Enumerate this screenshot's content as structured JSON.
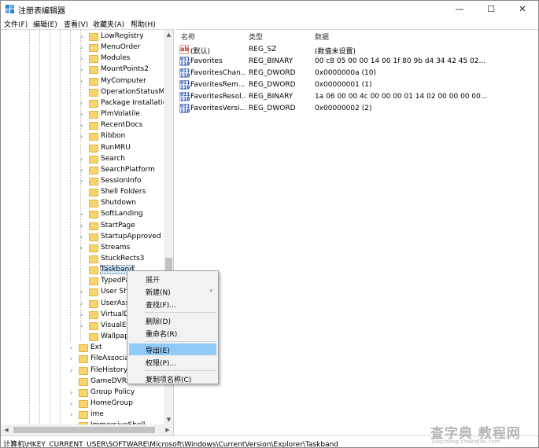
{
  "window": {
    "title": "注册表编辑器",
    "controls": [
      "—",
      "☐",
      "✕"
    ]
  },
  "menubar": [
    "文件(F)",
    "编辑(E)",
    "查看(V)",
    "收藏夹(A)",
    "帮助(H)"
  ],
  "tree": {
    "items": [
      {
        "label": "LowRegistry",
        "depth": 2,
        "expandable": true
      },
      {
        "label": "MenuOrder",
        "depth": 2,
        "expandable": true
      },
      {
        "label": "Modules",
        "depth": 2,
        "expandable": true
      },
      {
        "label": "MountPoints2",
        "depth": 2,
        "expandable": true
      },
      {
        "label": "MyComputer",
        "depth": 2,
        "expandable": true
      },
      {
        "label": "OperationStatusMa",
        "depth": 2,
        "expandable": false
      },
      {
        "label": "Package Installation",
        "depth": 2,
        "expandable": true
      },
      {
        "label": "PlmVolatile",
        "depth": 2,
        "expandable": true
      },
      {
        "label": "RecentDocs",
        "depth": 2,
        "expandable": true
      },
      {
        "label": "Ribbon",
        "depth": 2,
        "expandable": true
      },
      {
        "label": "RunMRU",
        "depth": 2,
        "expandable": false
      },
      {
        "label": "Search",
        "depth": 2,
        "expandable": true
      },
      {
        "label": "SearchPlatform",
        "depth": 2,
        "expandable": true
      },
      {
        "label": "SessionInfo",
        "depth": 2,
        "expandable": true
      },
      {
        "label": "Shell Folders",
        "depth": 2,
        "expandable": false
      },
      {
        "label": "Shutdown",
        "depth": 2,
        "expandable": false
      },
      {
        "label": "SoftLanding",
        "depth": 2,
        "expandable": true
      },
      {
        "label": "StartPage",
        "depth": 2,
        "expandable": true
      },
      {
        "label": "StartupApproved",
        "depth": 2,
        "expandable": true
      },
      {
        "label": "Streams",
        "depth": 2,
        "expandable": true
      },
      {
        "label": "StuckRects3",
        "depth": 2,
        "expandable": false
      },
      {
        "label": "Taskband",
        "depth": 2,
        "expandable": false,
        "selected": true
      },
      {
        "label": "TypedPa",
        "depth": 2,
        "expandable": false
      },
      {
        "label": "User Sh",
        "depth": 2,
        "expandable": true
      },
      {
        "label": "UserAss",
        "depth": 2,
        "expandable": true
      },
      {
        "label": "VirtualD",
        "depth": 2,
        "expandable": true
      },
      {
        "label": "VisualEf",
        "depth": 2,
        "expandable": true
      },
      {
        "label": "Wallpap",
        "depth": 2,
        "expandable": false
      },
      {
        "label": "Ext",
        "depth": 1,
        "expandable": true
      },
      {
        "label": "FileAssociati",
        "depth": 1,
        "expandable": true
      },
      {
        "label": "FileHistory",
        "depth": 1,
        "expandable": true
      },
      {
        "label": "GameDVR",
        "depth": 1,
        "expandable": false
      },
      {
        "label": "Group Policy",
        "depth": 1,
        "expandable": true
      },
      {
        "label": "HomeGroup",
        "depth": 1,
        "expandable": true
      },
      {
        "label": "ime",
        "depth": 1,
        "expandable": true
      },
      {
        "label": "ImmersiveShell",
        "depth": 1,
        "expandable": true
      }
    ]
  },
  "list": {
    "columns": [
      "名称",
      "类型",
      "数据"
    ],
    "rows": [
      {
        "icon": "ab",
        "name": "(默认)",
        "type": "REG_SZ",
        "data": "(数值未设置)"
      },
      {
        "icon": "bin",
        "name": "Favorites",
        "type": "REG_BINARY",
        "data": "00 c8 05 00 00 14 00 1f 80 9b d4 34 42 45 02..."
      },
      {
        "icon": "bin",
        "name": "FavoritesChan...",
        "type": "REG_DWORD",
        "data": "0x0000000a (10)"
      },
      {
        "icon": "bin",
        "name": "FavoritesRem...",
        "type": "REG_DWORD",
        "data": "0x00000001 (1)"
      },
      {
        "icon": "bin",
        "name": "FavoritesResol...",
        "type": "REG_BINARY",
        "data": "1a 06 00 00 4c 00 00 00 01 14 02 00 00 00 00..."
      },
      {
        "icon": "bin",
        "name": "FavoritesVersi...",
        "type": "REG_DWORD",
        "data": "0x00000002 (2)"
      }
    ]
  },
  "context_menu": {
    "items": [
      {
        "label": "展开",
        "grey": true
      },
      {
        "label": "新建(N)",
        "submenu": "›"
      },
      {
        "label": "查找(F)..."
      },
      {
        "sep": true
      },
      {
        "label": "删除(D)"
      },
      {
        "label": "重命名(R)"
      },
      {
        "sep": true
      },
      {
        "label": "导出(E)",
        "highlighted": true
      },
      {
        "label": "权限(P)..."
      },
      {
        "sep": true
      },
      {
        "label": "复制项名称(C)"
      }
    ]
  },
  "status": {
    "path": "计算机\\HKEY_CURRENT_USER\\SOFTWARE\\Microsoft\\Windows\\CurrentVersion\\Explorer\\Taskband"
  },
  "watermark": {
    "main": "查字典 教程网",
    "sub": "jiaocheng.chazidian.com"
  }
}
